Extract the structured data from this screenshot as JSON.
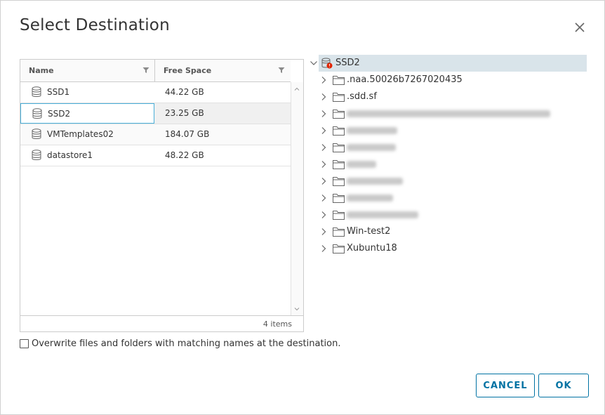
{
  "dialog": {
    "title": "Select Destination"
  },
  "datastore_grid": {
    "columns": [
      "Name",
      "Free Space"
    ],
    "rows": [
      {
        "name": "SSD1",
        "free_space": "44.22 GB"
      },
      {
        "name": "SSD2",
        "free_space": "23.25 GB"
      },
      {
        "name": "VMTemplates02",
        "free_space": "184.07 GB"
      },
      {
        "name": "datastore1",
        "free_space": "48.22 GB"
      }
    ],
    "selected_row": "SSD2",
    "footer": "4 items"
  },
  "overwrite_option": {
    "label": "Overwrite files and folders with matching names at the destination.",
    "checked": false
  },
  "tree": {
    "root": "SSD2",
    "children": [
      {
        "label": ".naa.50026b7267020435",
        "redacted": false
      },
      {
        "label": ".sdd.sf",
        "redacted": false
      },
      {
        "label": "",
        "redacted": true
      },
      {
        "label": "",
        "redacted": true
      },
      {
        "label": "",
        "redacted": true
      },
      {
        "label": "",
        "redacted": true
      },
      {
        "label": "",
        "redacted": true
      },
      {
        "label": "",
        "redacted": true
      },
      {
        "label": "",
        "redacted": true
      },
      {
        "label": "Win-test2",
        "redacted": false
      },
      {
        "label": "Xubuntu18",
        "redacted": false
      }
    ]
  },
  "buttons": {
    "cancel": "CANCEL",
    "ok": "OK"
  },
  "colors": {
    "accent": "#0072a3",
    "selection_border": "#49afd9",
    "tree_selected_bg": "#d9e4ea",
    "warning_badge": "#e12200"
  }
}
